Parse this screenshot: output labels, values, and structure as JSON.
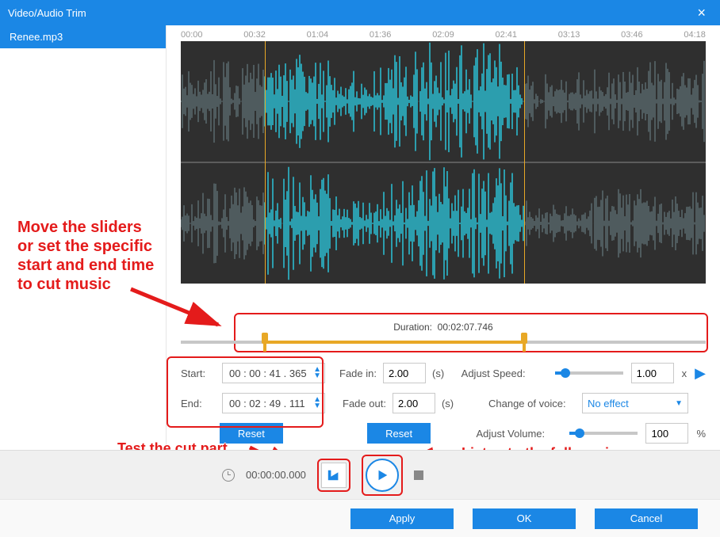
{
  "title": "Video/Audio Trim",
  "sidebar": {
    "file": "Renee.mp3"
  },
  "timeline": {
    "ticks": [
      "00:00",
      "00:32",
      "01:04",
      "01:36",
      "02:09",
      "02:41",
      "03:13",
      "03:46",
      "04:18"
    ],
    "sel_start_pct": 16.0,
    "sel_end_pct": 65.4
  },
  "duration": {
    "label": "Duration:",
    "value": "00:02:07.746"
  },
  "trim": {
    "start_label": "Start:",
    "start_value": "00 : 00 : 41 . 365",
    "end_label": "End:",
    "end_value": "00 : 02 : 49 . 111",
    "reset": "Reset"
  },
  "fade": {
    "in_label": "Fade in:",
    "in_value": "2.00",
    "out_label": "Fade out:",
    "out_value": "2.00",
    "unit": "(s)",
    "reset": "Reset"
  },
  "speed": {
    "label": "Adjust Speed:",
    "value": "1.00",
    "unit": "x",
    "pos_pct": 15
  },
  "voice": {
    "label": "Change of voice:",
    "value": "No effect"
  },
  "volume": {
    "label": "Adjust Volume:",
    "value": "100",
    "unit": "%",
    "pos_pct": 15
  },
  "player": {
    "time": "00:00:00.000"
  },
  "footer": {
    "apply": "Apply",
    "ok": "OK",
    "cancel": "Cancel"
  },
  "annotations": {
    "a1": "Move the sliders or set the specific start and end time to cut music",
    "a2": "Test the cut part",
    "a3": "Listen to the full music"
  }
}
